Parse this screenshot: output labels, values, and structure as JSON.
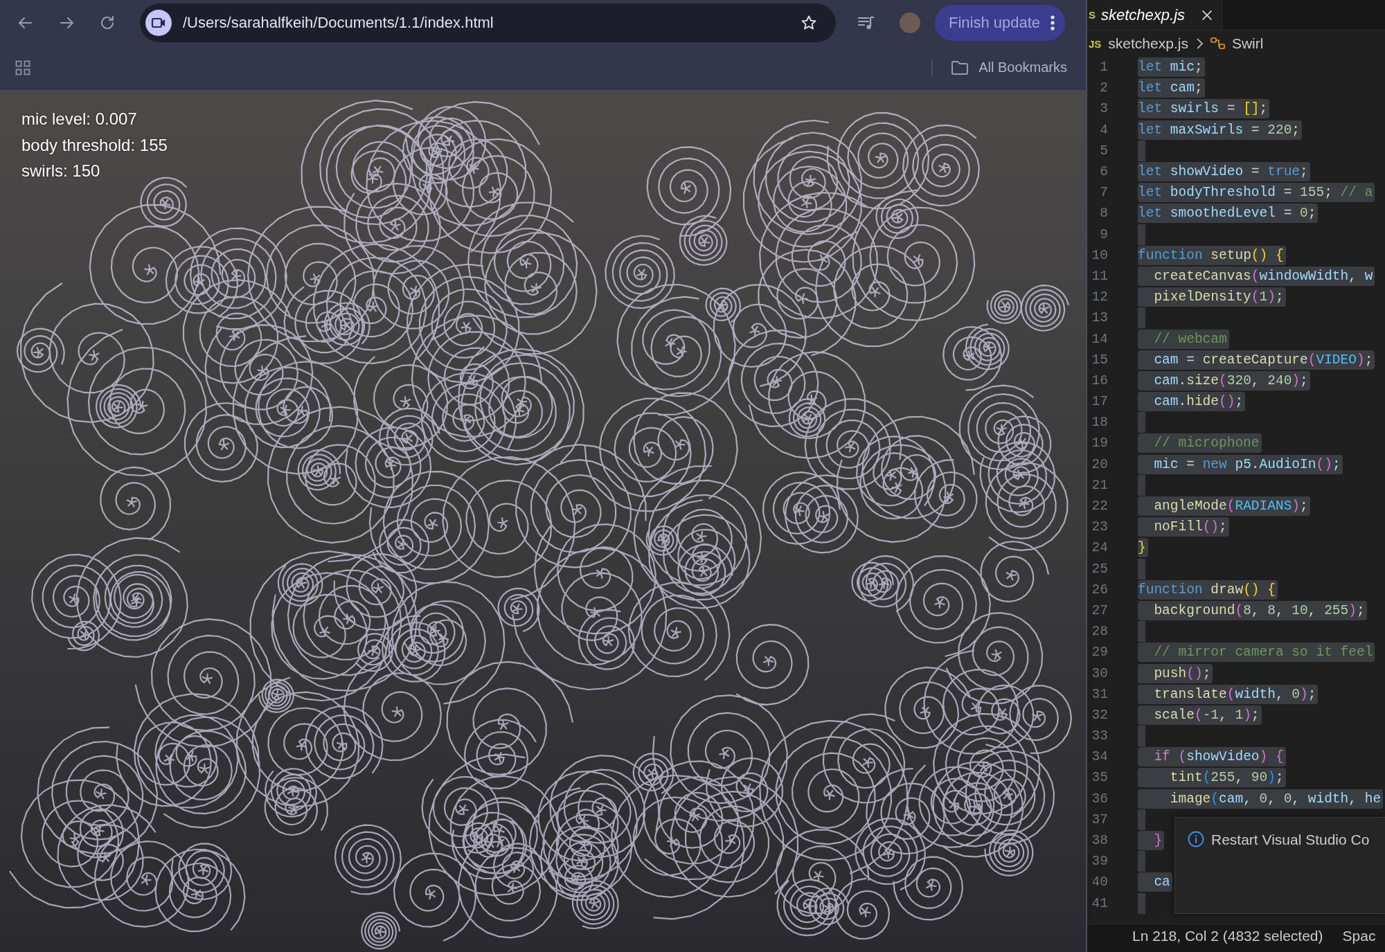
{
  "browser": {
    "toolbar": {
      "url": "/Users/sarahalfkeih/Documents/1.1/index.html",
      "update_button": "Finish update"
    },
    "bookmarks_bar": {
      "all_bookmarks": "All Bookmarks"
    },
    "sketch": {
      "overlay_lines": [
        "mic level: 0.007",
        "body threshold: 155",
        "swirls: 150"
      ]
    }
  },
  "editor": {
    "tabs": [
      {
        "icon_text": "S",
        "label": "sketchexp.js",
        "preview": true,
        "selected": true
      }
    ],
    "breadcrumb": {
      "file_icon_text": "JS",
      "file": "sketchexp.js",
      "symbol": "Swirl"
    },
    "selection_shown": true,
    "lines": [
      {
        "number": "1",
        "tokens": [
          {
            "kind": "keyword",
            "text": "let "
          },
          {
            "kind": "variable",
            "text": "mic"
          },
          {
            "kind": "plain",
            "text": ";"
          }
        ]
      },
      {
        "number": "2",
        "tokens": [
          {
            "kind": "keyword",
            "text": "let "
          },
          {
            "kind": "variable",
            "text": "cam"
          },
          {
            "kind": "plain",
            "text": ";"
          }
        ]
      },
      {
        "number": "3",
        "tokens": [
          {
            "kind": "keyword",
            "text": "let "
          },
          {
            "kind": "variable",
            "text": "swirls"
          },
          {
            "kind": "plain",
            "text": " = "
          },
          {
            "kind": "bracket1",
            "text": "[]"
          },
          {
            "kind": "plain",
            "text": ";"
          }
        ]
      },
      {
        "number": "4",
        "tokens": [
          {
            "kind": "keyword",
            "text": "let "
          },
          {
            "kind": "variable",
            "text": "maxSwirls"
          },
          {
            "kind": "plain",
            "text": " = "
          },
          {
            "kind": "number",
            "text": "220"
          },
          {
            "kind": "plain",
            "text": ";"
          }
        ]
      },
      {
        "number": "5"
      },
      {
        "number": "6",
        "tokens": [
          {
            "kind": "keyword",
            "text": "let "
          },
          {
            "kind": "variable",
            "text": "showVideo"
          },
          {
            "kind": "plain",
            "text": " = "
          },
          {
            "kind": "keyword",
            "text": "true"
          },
          {
            "kind": "plain",
            "text": ";"
          }
        ]
      },
      {
        "number": "7",
        "tokens": [
          {
            "kind": "keyword",
            "text": "let "
          },
          {
            "kind": "variable",
            "text": "bodyThreshold"
          },
          {
            "kind": "plain",
            "text": " = "
          },
          {
            "kind": "number",
            "text": "155"
          },
          {
            "kind": "plain",
            "text": "; "
          },
          {
            "kind": "comment",
            "text": "// a"
          }
        ]
      },
      {
        "number": "8",
        "tokens": [
          {
            "kind": "keyword",
            "text": "let "
          },
          {
            "kind": "variable",
            "text": "smoothedLevel"
          },
          {
            "kind": "plain",
            "text": " = "
          },
          {
            "kind": "number",
            "text": "0"
          },
          {
            "kind": "plain",
            "text": ";"
          }
        ]
      },
      {
        "number": "9"
      },
      {
        "number": "10",
        "tokens": [
          {
            "kind": "keyword",
            "text": "function "
          },
          {
            "kind": "function",
            "text": "setup"
          },
          {
            "kind": "bracket1",
            "text": "() {"
          }
        ]
      },
      {
        "number": "11",
        "tokens": [
          {
            "kind": "function",
            "text": "  createCanvas"
          },
          {
            "kind": "bracket2",
            "text": "("
          },
          {
            "kind": "variable",
            "text": "windowWidth"
          },
          {
            "kind": "plain",
            "text": ", "
          },
          {
            "kind": "variable",
            "text": "w"
          }
        ]
      },
      {
        "number": "12",
        "tokens": [
          {
            "kind": "function",
            "text": "  pixelDensity"
          },
          {
            "kind": "bracket2",
            "text": "("
          },
          {
            "kind": "number",
            "text": "1"
          },
          {
            "kind": "bracket2",
            "text": ")"
          },
          {
            "kind": "plain",
            "text": ";"
          }
        ]
      },
      {
        "number": "13"
      },
      {
        "number": "14",
        "tokens": [
          {
            "kind": "comment",
            "text": "  // webcam"
          }
        ]
      },
      {
        "number": "15",
        "tokens": [
          {
            "kind": "variable",
            "text": "  cam"
          },
          {
            "kind": "plain",
            "text": " = "
          },
          {
            "kind": "function",
            "text": "createCapture"
          },
          {
            "kind": "bracket2",
            "text": "("
          },
          {
            "kind": "constant",
            "text": "VIDEO"
          },
          {
            "kind": "bracket2",
            "text": ")"
          },
          {
            "kind": "plain",
            "text": ";"
          }
        ]
      },
      {
        "number": "16",
        "tokens": [
          {
            "kind": "variable",
            "text": "  cam"
          },
          {
            "kind": "plain",
            "text": "."
          },
          {
            "kind": "function",
            "text": "size"
          },
          {
            "kind": "bracket2",
            "text": "("
          },
          {
            "kind": "number",
            "text": "320"
          },
          {
            "kind": "plain",
            "text": ", "
          },
          {
            "kind": "number",
            "text": "240"
          },
          {
            "kind": "bracket2",
            "text": ")"
          },
          {
            "kind": "plain",
            "text": ";"
          }
        ]
      },
      {
        "number": "17",
        "tokens": [
          {
            "kind": "variable",
            "text": "  cam"
          },
          {
            "kind": "plain",
            "text": "."
          },
          {
            "kind": "function",
            "text": "hide"
          },
          {
            "kind": "bracket2",
            "text": "()"
          },
          {
            "kind": "plain",
            "text": ";"
          }
        ]
      },
      {
        "number": "18"
      },
      {
        "number": "19",
        "tokens": [
          {
            "kind": "comment",
            "text": "  // microphone"
          }
        ]
      },
      {
        "number": "20",
        "tokens": [
          {
            "kind": "variable",
            "text": "  mic"
          },
          {
            "kind": "plain",
            "text": " = "
          },
          {
            "kind": "keyword",
            "text": "new "
          },
          {
            "kind": "variable",
            "text": "p5"
          },
          {
            "kind": "plain",
            "text": "."
          },
          {
            "kind": "variable",
            "text": "AudioIn"
          },
          {
            "kind": "bracket2",
            "text": "()"
          },
          {
            "kind": "plain",
            "text": ";"
          }
        ]
      },
      {
        "number": "21"
      },
      {
        "number": "22",
        "tokens": [
          {
            "kind": "function",
            "text": "  angleMode"
          },
          {
            "kind": "bracket2",
            "text": "("
          },
          {
            "kind": "constant",
            "text": "RADIANS"
          },
          {
            "kind": "bracket2",
            "text": ")"
          },
          {
            "kind": "plain",
            "text": ";"
          }
        ]
      },
      {
        "number": "23",
        "tokens": [
          {
            "kind": "function",
            "text": "  noFill"
          },
          {
            "kind": "bracket2",
            "text": "()"
          },
          {
            "kind": "plain",
            "text": ";"
          }
        ]
      },
      {
        "number": "24",
        "tokens": [
          {
            "kind": "bracket1",
            "text": "}"
          }
        ]
      },
      {
        "number": "25"
      },
      {
        "number": "26",
        "tokens": [
          {
            "kind": "keyword",
            "text": "function "
          },
          {
            "kind": "function",
            "text": "draw"
          },
          {
            "kind": "bracket1",
            "text": "() {"
          }
        ]
      },
      {
        "number": "27",
        "tokens": [
          {
            "kind": "function",
            "text": "  background"
          },
          {
            "kind": "bracket2",
            "text": "("
          },
          {
            "kind": "number",
            "text": "8"
          },
          {
            "kind": "plain",
            "text": ", "
          },
          {
            "kind": "number",
            "text": "8"
          },
          {
            "kind": "plain",
            "text": ", "
          },
          {
            "kind": "number",
            "text": "10"
          },
          {
            "kind": "plain",
            "text": ", "
          },
          {
            "kind": "number",
            "text": "255"
          },
          {
            "kind": "bracket2",
            "text": ")"
          },
          {
            "kind": "plain",
            "text": ";"
          }
        ]
      },
      {
        "number": "28"
      },
      {
        "number": "29",
        "tokens": [
          {
            "kind": "comment",
            "text": "  // mirror camera so it feel"
          }
        ]
      },
      {
        "number": "30",
        "tokens": [
          {
            "kind": "function",
            "text": "  push"
          },
          {
            "kind": "bracket2",
            "text": "()"
          },
          {
            "kind": "plain",
            "text": ";"
          }
        ]
      },
      {
        "number": "31",
        "tokens": [
          {
            "kind": "function",
            "text": "  translate"
          },
          {
            "kind": "bracket2",
            "text": "("
          },
          {
            "kind": "variable",
            "text": "width"
          },
          {
            "kind": "plain",
            "text": ", "
          },
          {
            "kind": "number",
            "text": "0"
          },
          {
            "kind": "bracket2",
            "text": ")"
          },
          {
            "kind": "plain",
            "text": ";"
          }
        ]
      },
      {
        "number": "32",
        "tokens": [
          {
            "kind": "function",
            "text": "  scale"
          },
          {
            "kind": "bracket2",
            "text": "("
          },
          {
            "kind": "number",
            "text": "-1"
          },
          {
            "kind": "plain",
            "text": ", "
          },
          {
            "kind": "number",
            "text": "1"
          },
          {
            "kind": "bracket2",
            "text": ")"
          },
          {
            "kind": "plain",
            "text": ";"
          }
        ]
      },
      {
        "number": "33"
      },
      {
        "number": "34",
        "tokens": [
          {
            "kind": "control",
            "text": "  if "
          },
          {
            "kind": "bracket2",
            "text": "("
          },
          {
            "kind": "variable",
            "text": "showVideo"
          },
          {
            "kind": "bracket2",
            "text": ") {"
          }
        ]
      },
      {
        "number": "35",
        "tokens": [
          {
            "kind": "function",
            "text": "    tint"
          },
          {
            "kind": "bracket3",
            "text": "("
          },
          {
            "kind": "number",
            "text": "255"
          },
          {
            "kind": "plain",
            "text": ", "
          },
          {
            "kind": "number",
            "text": "90"
          },
          {
            "kind": "bracket3",
            "text": ")"
          },
          {
            "kind": "plain",
            "text": ";"
          }
        ]
      },
      {
        "number": "36",
        "tokens": [
          {
            "kind": "function",
            "text": "    image"
          },
          {
            "kind": "bracket3",
            "text": "("
          },
          {
            "kind": "variable",
            "text": "cam"
          },
          {
            "kind": "plain",
            "text": ", "
          },
          {
            "kind": "number",
            "text": "0"
          },
          {
            "kind": "plain",
            "text": ", "
          },
          {
            "kind": "number",
            "text": "0"
          },
          {
            "kind": "plain",
            "text": ", "
          },
          {
            "kind": "variable",
            "text": "width"
          },
          {
            "kind": "plain",
            "text": ", "
          },
          {
            "kind": "variable",
            "text": "he"
          }
        ]
      },
      {
        "number": "37"
      },
      {
        "number": "38",
        "tokens": [
          {
            "kind": "bracket2",
            "text": "  }"
          }
        ]
      },
      {
        "number": "39"
      },
      {
        "number": "40",
        "tokens": [
          {
            "kind": "variable",
            "text": "  ca"
          }
        ]
      },
      {
        "number": "41"
      }
    ],
    "notification": {
      "message": "Restart Visual Studio Co"
    },
    "status_bar": {
      "cursor": "Ln 218, Col 2 (4832 selected)",
      "indentation": "Spac"
    }
  }
}
